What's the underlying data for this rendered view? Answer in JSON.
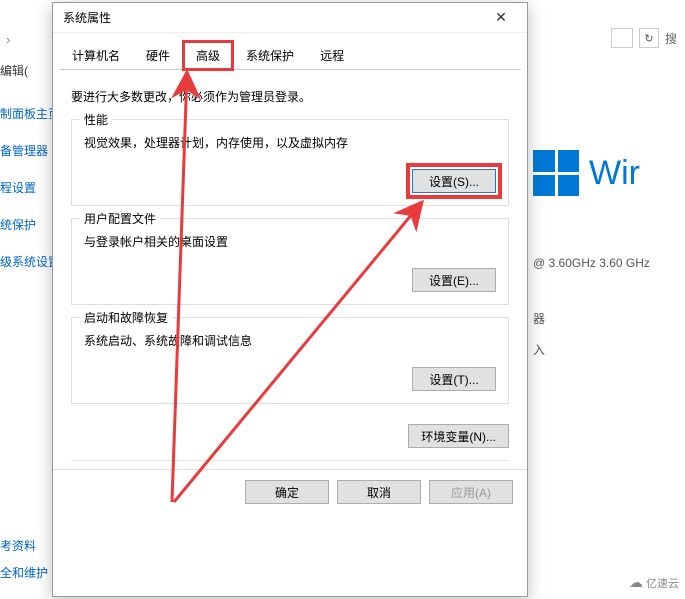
{
  "background": {
    "edit_label": "编辑(",
    "left_links": [
      "制面板主页",
      "备管理器",
      "程设置",
      "统保护",
      "级系统设置"
    ],
    "bottom_links": [
      "考资料",
      "全和维护"
    ],
    "cpu": "@ 3.60GHz   3.60 GHz",
    "side1": "器",
    "side2": "入",
    "win_text": "Wir",
    "search_label": "搜",
    "nav_arrow": "›"
  },
  "dialog": {
    "title": "系统属性",
    "tabs": [
      "计算机名",
      "硬件",
      "高级",
      "系统保护",
      "远程"
    ],
    "active_tab_index": 2,
    "notice": "要进行大多数更改，你必须作为管理员登录。",
    "groups": {
      "perf": {
        "title": "性能",
        "desc": "视觉效果，处理器计划，内存使用，以及虚拟内存",
        "button": "设置(S)..."
      },
      "profile": {
        "title": "用户配置文件",
        "desc": "与登录帐户相关的桌面设置",
        "button": "设置(E)..."
      },
      "startup": {
        "title": "启动和故障恢复",
        "desc": "系统启动、系统故障和调试信息",
        "button": "设置(T)..."
      }
    },
    "envvar_button": "环境变量(N)...",
    "footer": {
      "ok": "确定",
      "cancel": "取消",
      "apply": "应用(A)"
    }
  },
  "watermark": "亿速云",
  "annotation_color": "#e93b3b"
}
